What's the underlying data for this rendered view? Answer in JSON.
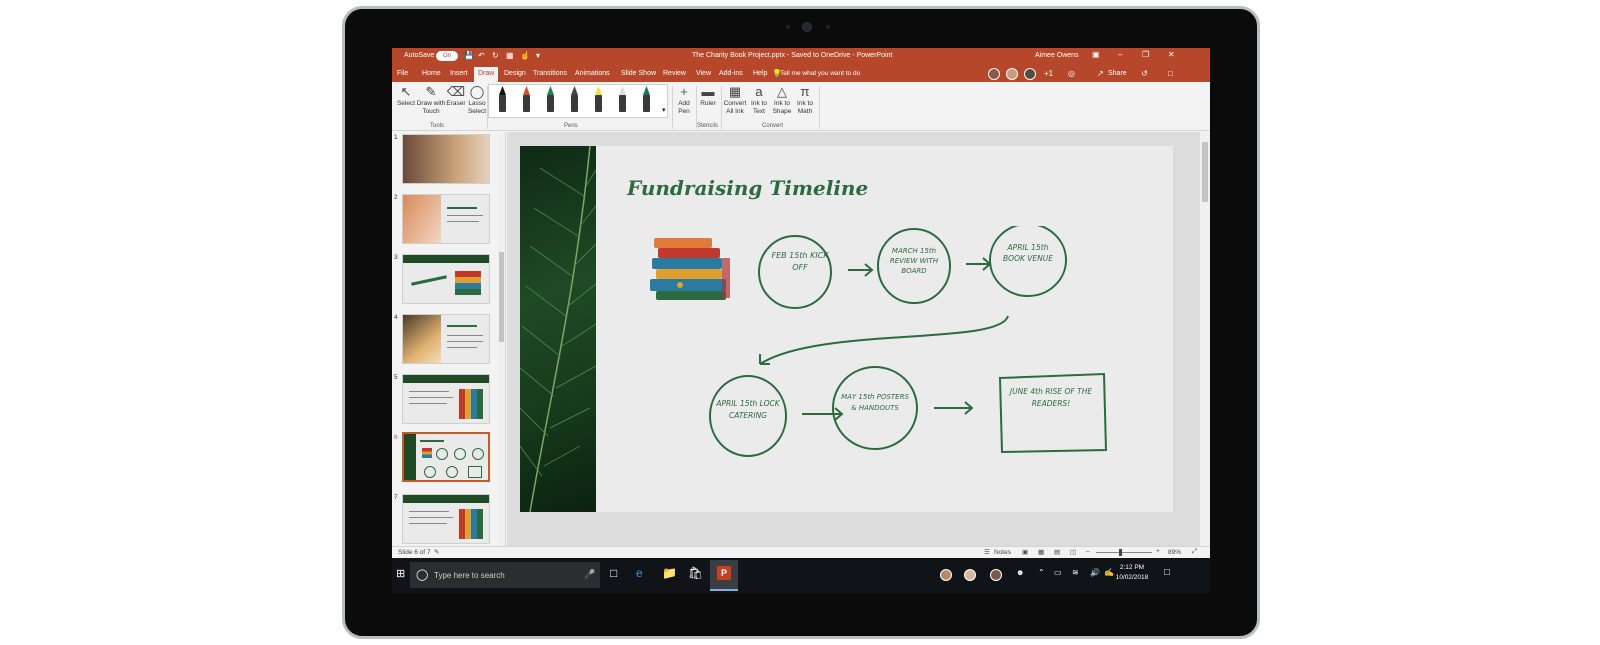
{
  "titlebar": {
    "autosave_label": "AutoSave",
    "autosave_state": "On",
    "doc_title": "The Charity Book Project.pptx - Saved to OneDrive - PowerPoint",
    "user_name": "Aimee Owens"
  },
  "tabs": [
    "File",
    "Home",
    "Insert",
    "Draw",
    "Design",
    "Transitions",
    "Animations",
    "Slide Show",
    "Review",
    "View",
    "Add-ins",
    "Help"
  ],
  "active_tab": "Draw",
  "tell_me": "Tell me what you want to do",
  "share_label": "Share",
  "ribbon": {
    "tools": [
      {
        "label1": "Select",
        "label2": "",
        "icon": "select-arrow-icon"
      },
      {
        "label1": "Draw with",
        "label2": "Touch",
        "icon": "draw-touch-icon"
      },
      {
        "label1": "Eraser",
        "label2": "",
        "icon": "eraser-icon"
      },
      {
        "label1": "Lasso",
        "label2": "Select",
        "icon": "lasso-icon"
      }
    ],
    "tools_group": "Tools",
    "pens_group": "Pens",
    "pen_colors": [
      "#111111",
      "#e04a1c",
      "#1f7a5a",
      "#444444",
      "#f5e12a",
      "#dddddd",
      "#1d6e63"
    ],
    "add_pen": {
      "label1": "Add",
      "label2": "Pen"
    },
    "ruler": {
      "label1": "Ruler"
    },
    "stencils_group": "Stencils",
    "convert": [
      {
        "label1": "Convert",
        "label2": "All Ink",
        "icon": "convert-ink-icon"
      },
      {
        "label1": "Ink to",
        "label2": "Text",
        "icon": "ink-to-text-icon"
      },
      {
        "label1": "Ink to",
        "label2": "Shape",
        "icon": "ink-to-shape-icon"
      },
      {
        "label1": "Ink to",
        "label2": "Math",
        "icon": "ink-to-math-icon"
      }
    ],
    "convert_group": "Convert"
  },
  "thumbnails": [
    {
      "num": "1"
    },
    {
      "num": "2"
    },
    {
      "num": "3"
    },
    {
      "num": "4"
    },
    {
      "num": "5"
    },
    {
      "num": "6"
    },
    {
      "num": "7"
    }
  ],
  "selected_slide": "6",
  "slide": {
    "title": "Fundraising Timeline",
    "nodes": [
      {
        "text": "FEB 15th KICK OFF"
      },
      {
        "text": "MARCH 15th REVIEW WITH BOARD"
      },
      {
        "text": "APRIL 15th BOOK VENUE"
      },
      {
        "text": "APRIL 15th LOCK CATERING"
      },
      {
        "text": "MAY 15th POSTERS & HANDOUTS"
      },
      {
        "text": "JUNE 4th RISE OF THE READERS!"
      }
    ]
  },
  "statusbar": {
    "slide_info": "Slide 6 of 7",
    "notes": "Notes",
    "zoom": "89%"
  },
  "taskbar": {
    "search_placeholder": "Type here to search",
    "time": "2:12 PM",
    "date": "10/02/2018"
  }
}
